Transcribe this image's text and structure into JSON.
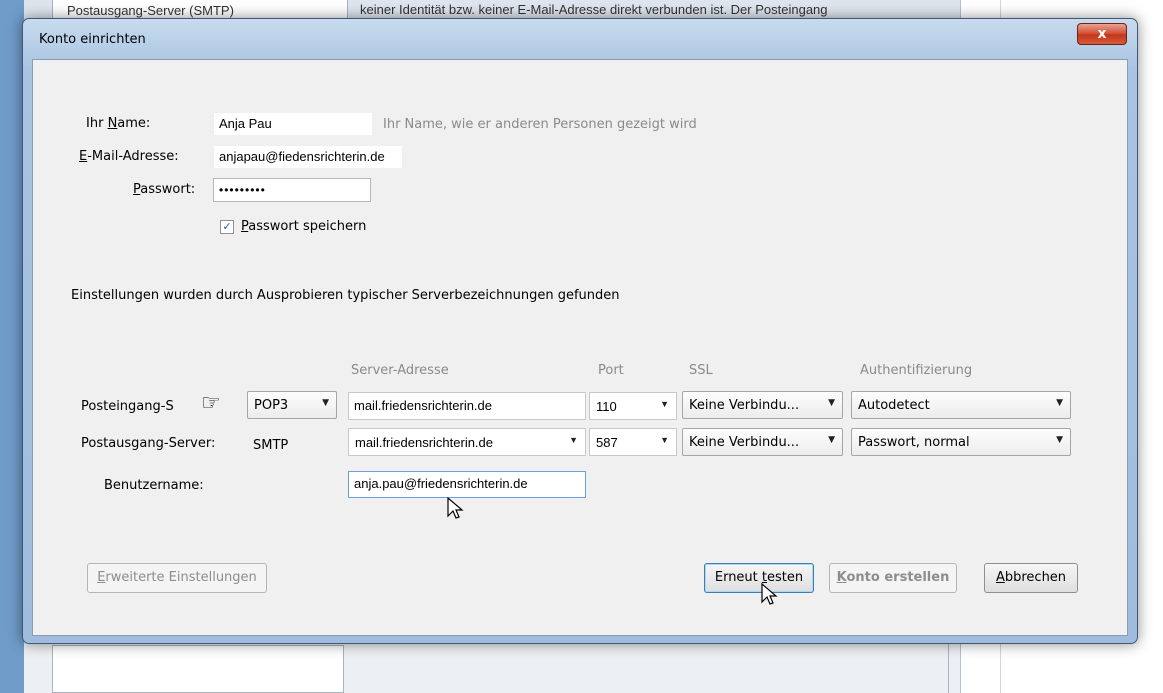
{
  "background": {
    "top_tab_text": "Postausgang-Server (SMTP)",
    "top_text": "keiner Identität bzw. keiner E-Mail-Adresse direkt verbunden ist. Der Posteingang"
  },
  "window": {
    "title": "Konto einrichten",
    "close_label": "x"
  },
  "form": {
    "name_label_prefix": "Ihr ",
    "name_label_accel": "N",
    "name_label_suffix": "ame:",
    "name_value": "Anja Pau",
    "name_hint": "Ihr Name, wie er anderen Personen gezeigt wird",
    "email_label_accel": "E",
    "email_label_suffix": "-Mail-Adresse:",
    "email_value": "anjapau@fiedensrichterin.de",
    "password_label_accel": "P",
    "password_label_suffix": "asswort:",
    "password_value": "•••••••••",
    "save_password_accel": "P",
    "save_password_suffix": "asswort speichern",
    "save_password_checked": "✓"
  },
  "status_message": "Einstellungen wurden durch Ausprobieren typischer Serverbezeichnungen gefunden",
  "server_table": {
    "headers": {
      "server_address": "Server-Adresse",
      "port": "Port",
      "ssl": "SSL",
      "auth": "Authentifizierung"
    },
    "incoming": {
      "label": "Posteingang-S",
      "protocol": "POP3",
      "address": "mail.friedensrichterin.de",
      "port": "110",
      "ssl": "Keine Verbindu...",
      "auth": "Autodetect"
    },
    "outgoing": {
      "label": "Postausgang-Server:",
      "protocol": "SMTP",
      "address": "mail.friedensrichterin.de",
      "port": "587",
      "ssl": "Keine Verbindu...",
      "auth": "Passwort, normal"
    },
    "username": {
      "label": "Benutzername:",
      "value": "anja.pau@friedensrichterin.de"
    }
  },
  "buttons": {
    "advanced_accel": "E",
    "advanced_suffix": "rweiterte Einstellungen",
    "retest_prefix": "Erneut ",
    "retest_accel": "t",
    "retest_suffix": "esten",
    "create_prefix": "K",
    "create_suffix": "onto erstellen",
    "cancel_accel": "A",
    "cancel_suffix": "bbrechen"
  },
  "icons": {
    "pointing_hand": "☞",
    "dropdown_arrow": "▼"
  }
}
